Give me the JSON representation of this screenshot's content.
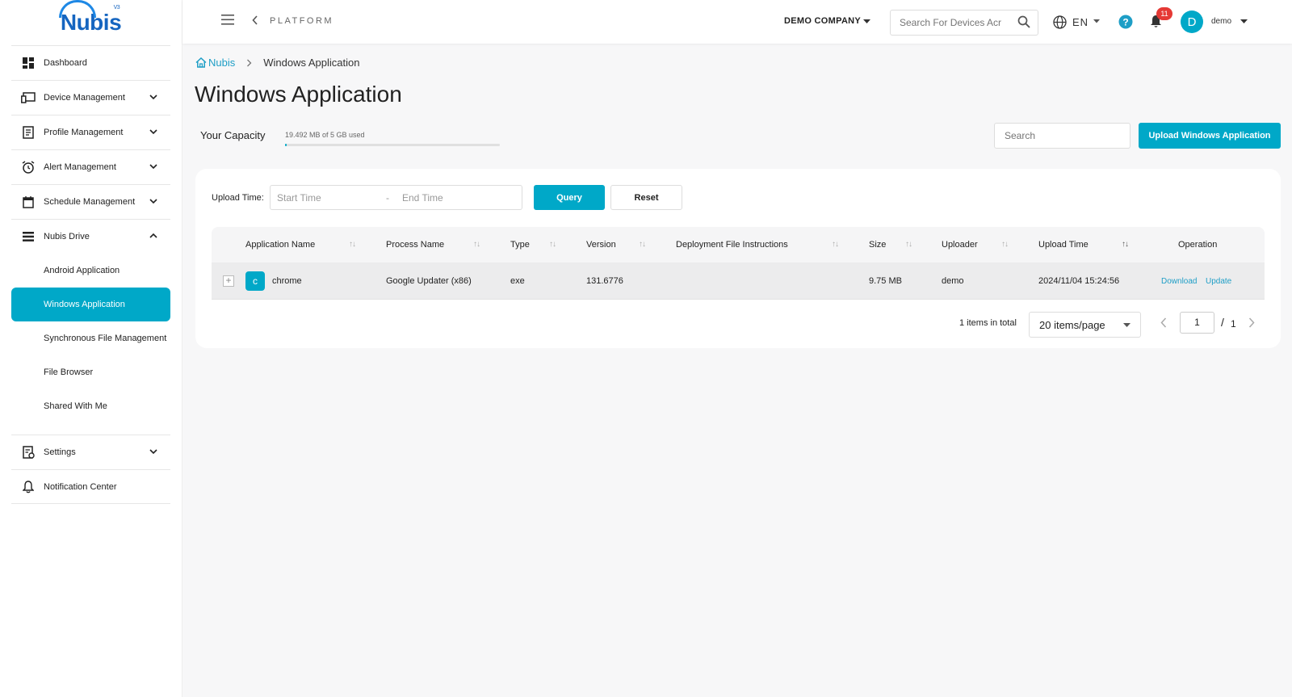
{
  "brand": {
    "name": "Nubis",
    "version": "V3"
  },
  "sidebar": {
    "items": [
      {
        "label": "Dashboard",
        "icon": "dashboard-icon"
      },
      {
        "label": "Device Management",
        "icon": "device-icon"
      },
      {
        "label": "Profile Management",
        "icon": "profile-icon"
      },
      {
        "label": "Alert Management",
        "icon": "alarm-clock-icon"
      },
      {
        "label": "Schedule Management",
        "icon": "calendar-icon"
      },
      {
        "label": "Nubis Drive",
        "icon": "list-icon"
      }
    ],
    "drive_sub": [
      {
        "label": "Android Application"
      },
      {
        "label": "Windows Application"
      },
      {
        "label": "Synchronous File Management"
      },
      {
        "label": "File Browser"
      },
      {
        "label": "Shared With Me"
      }
    ],
    "bottom": [
      {
        "label": "Settings",
        "icon": "settings-doc-icon"
      },
      {
        "label": "Notification Center",
        "icon": "bell-icon"
      }
    ]
  },
  "header": {
    "platform": "PLATFORM",
    "company": "DEMO COMPANY",
    "search_placeholder": "Search For Devices Acr",
    "language": "EN",
    "notification_count": "11",
    "avatar_letter": "D",
    "username": "demo"
  },
  "breadcrumb": {
    "home": "Nubis",
    "current": "Windows Application"
  },
  "page": {
    "title": "Windows Application",
    "capacity_label": "Your Capacity",
    "capacity_text": "19.492 MB of 5 GB used",
    "capacity_fraction": 0.004,
    "search_placeholder": "Search",
    "upload_label": "Upload Windows Application"
  },
  "filters": {
    "upload_time_label": "Upload Time:",
    "start_placeholder": "Start Time",
    "range_sep": "-",
    "end_placeholder": "End Time",
    "query_label": "Query",
    "reset_label": "Reset"
  },
  "table": {
    "headers": {
      "app_name": "Application Name",
      "process_name": "Process Name",
      "type": "Type",
      "version": "Version",
      "deploy": "Deployment File Instructions",
      "size": "Size",
      "uploader": "Uploader",
      "upload_time": "Upload Time",
      "operation": "Operation"
    },
    "rows": [
      {
        "icon_letter": "c",
        "app_name": "chrome",
        "process_name": "Google Updater (x86)",
        "type": "exe",
        "version": "131.6776",
        "deploy": "",
        "size": "9.75 MB",
        "uploader": "demo",
        "upload_time": "2024/11/04 15:24:56",
        "download_label": "Download",
        "update_label": "Update"
      }
    ]
  },
  "pagination": {
    "total_text": "1 items in total",
    "page_size": "20 items/page",
    "current_page": "1",
    "separator": "/",
    "total_pages": "1"
  },
  "colors": {
    "accent": "#00a8c8",
    "link": "#1e9ec6",
    "badge": "#e53935",
    "brand": "#1565c0"
  }
}
